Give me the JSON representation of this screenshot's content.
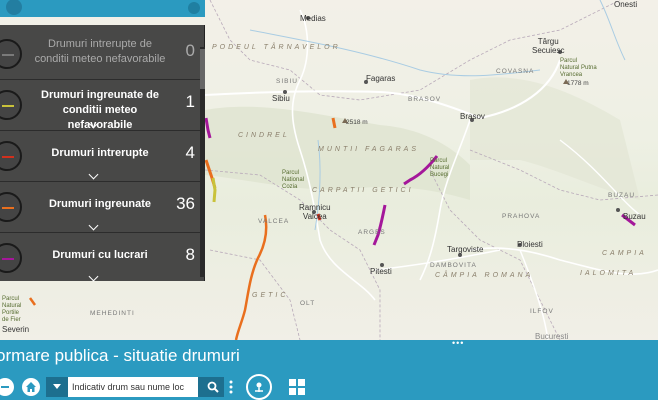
{
  "map": {
    "towns": [
      {
        "id": "medias",
        "name": "Medias",
        "cls": ""
      },
      {
        "id": "tg-secuiesc",
        "name": "Târgu\nSecuiesc",
        "cls": ""
      },
      {
        "id": "onesti",
        "name": "Onesti",
        "cls": ""
      },
      {
        "id": "fagaras",
        "name": "Fagaras",
        "cls": ""
      },
      {
        "id": "sibiu",
        "name": "Sibiu",
        "cls": ""
      },
      {
        "id": "brasov",
        "name": "Brasov",
        "cls": ""
      },
      {
        "id": "ramnicu",
        "name": "Ramnicu\nValcea",
        "cls": ""
      },
      {
        "id": "pitesti",
        "name": "Pitesti",
        "cls": ""
      },
      {
        "id": "targoviste",
        "name": "Targoviste",
        "cls": ""
      },
      {
        "id": "ploiesti",
        "name": "Ploiesti",
        "cls": ""
      },
      {
        "id": "buzau",
        "name": "Buzau",
        "cls": ""
      },
      {
        "id": "severin",
        "name": "Severin",
        "cls": ""
      },
      {
        "id": "bucuresti",
        "name": "Bucuresti",
        "cls": ""
      }
    ],
    "labels": {
      "podeul": "PODEUL TÂRNAVELOR",
      "sibiu_county": "SIBIU",
      "brasov_county": "BRASOV",
      "covasna": "COVASNA",
      "fagaras_mt": "MUNTII FAGARAS",
      "cindrel": "CINDREL",
      "carpati": "CARPATII GETICI",
      "valcea": "VALCEA",
      "arges": "ARGES",
      "prahova": "PRAHOVA",
      "buzau_county": "BUZAU",
      "dambovita": "DAMBOVITA",
      "campia_romana": "CÂMPIA ROMANA",
      "campia": "CAMPIA",
      "ialomita": "IALOMITA",
      "getic": "GETIC",
      "olt": "OLT",
      "ilfov": "ILFOV",
      "mehedinti": "MEHEDINTI",
      "peak": "2518 m",
      "peak2": "1778 m",
      "park_cozia": "Parcul\nNational\nCozia",
      "park_bucegi": "Parcul\nNatural\nBucegi",
      "park_putna": "Parcul\nNatural Putna\nVrancea",
      "park_fier": "Parcul\nNatural\nPortile\nde Fier",
      "handle": "•••"
    }
  },
  "legend": {
    "items": [
      {
        "label": "Drumuri intrerupte de conditii meteo nefavorabile",
        "count": "0",
        "color": "#7a7a7a",
        "dim": true
      },
      {
        "label": "Drumuri ingreunate de conditii meteo nefavorabile",
        "count": "1",
        "color": "#c9c23a",
        "dim": false
      },
      {
        "label": "Drumuri intrerupte",
        "count": "4",
        "color": "#d2301d",
        "dim": false
      },
      {
        "label": "Drumuri ingreunate",
        "count": "36",
        "color": "#e96f1e",
        "dim": false
      },
      {
        "label": "Drumuri cu lucrari",
        "count": "8",
        "color": "#a4179a",
        "dim": false
      }
    ]
  },
  "app": {
    "title": "ormare publica - situatie drumuri"
  },
  "toolbar": {
    "search_placeholder": "Indicativ drum sau nume loc",
    "icons": [
      "minus-icon",
      "home-icon",
      "dropdown-icon",
      "search-icon",
      "more-vertical-icon",
      "location-icon",
      "grid-icon"
    ]
  },
  "colors": {
    "accent": "#2b9ac0",
    "panel": "#3a3a3a",
    "intrerupte": "#d2301d",
    "ingreunate": "#e96f1e",
    "lucrari": "#a4179a",
    "meteo_ingreunate": "#c9c23a"
  }
}
